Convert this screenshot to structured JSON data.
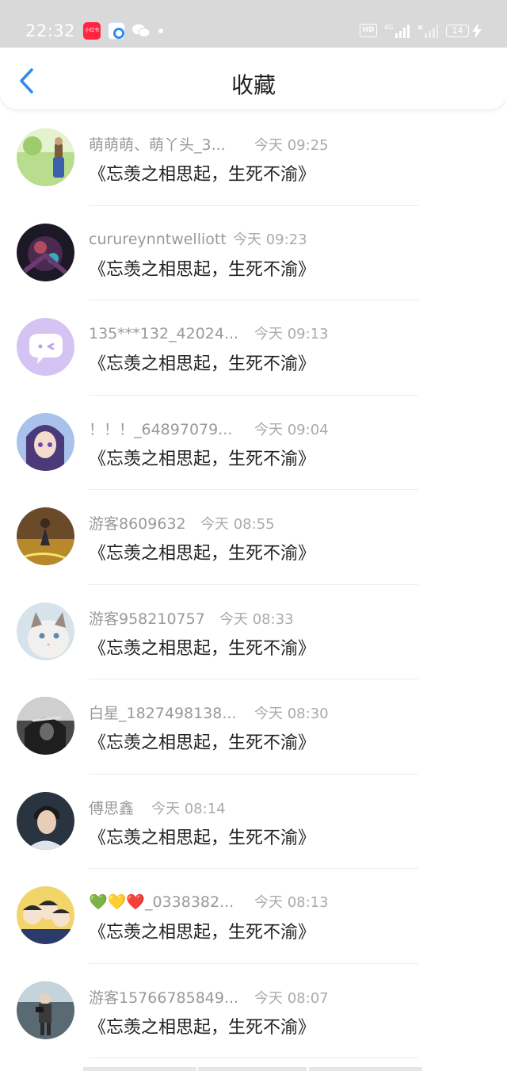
{
  "status_bar": {
    "time": "22:32",
    "red_app_label": "小红书",
    "hd_label": "HD",
    "network_label": "4G",
    "battery_level": "14"
  },
  "header": {
    "title": "收藏"
  },
  "colors": {
    "accent": "#2f8ce8",
    "username": "#999999",
    "title_text": "#222222",
    "status_bar_bg": "#d9d9d9"
  },
  "favorites": [
    {
      "username": "萌萌萌、萌丫头_3...",
      "time": "今天 09:25",
      "title": "《忘羡之相思起，生死不渝》",
      "avatar": "girl-in-field-avatar"
    },
    {
      "username": "curureynntwelliott",
      "time": "今天 09:23",
      "title": "《忘羡之相思起，生死不渝》",
      "avatar": "dark-warrior-avatar"
    },
    {
      "username": "135***132_42024...",
      "time": "今天 09:13",
      "title": "《忘羡之相思起，生死不渝》",
      "avatar": "default-chat-avatar"
    },
    {
      "username": "！！！_64897079...",
      "time": "今天 09:04",
      "title": "《忘羡之相思起，生死不渝》",
      "avatar": "anime-girl-avatar"
    },
    {
      "username": "游客8609632",
      "time": "今天 08:55",
      "title": "《忘羡之相思起，生死不渝》",
      "avatar": "stage-dancer-avatar"
    },
    {
      "username": "游客958210757",
      "time": "今天 08:33",
      "title": "《忘羡之相思起，生死不渝》",
      "avatar": "cat-avatar"
    },
    {
      "username": "白星_1827498138...",
      "time": "今天 08:30",
      "title": "《忘羡之相思起，生死不渝》",
      "avatar": "hooded-figure-avatar"
    },
    {
      "username": "傅思鑫",
      "time": "今天 08:14",
      "title": "《忘羡之相思起，生死不渝》",
      "avatar": "young-man-avatar"
    },
    {
      "username": "💚💛❤️_0338382...",
      "time": "今天 08:13",
      "title": "《忘羡之相思起，生死不渝》",
      "avatar": "cartoon-group-avatar"
    },
    {
      "username": "游客15766785849...",
      "time": "今天 08:07",
      "title": "《忘羡之相思起，生死不渝》",
      "avatar": "photographer-avatar"
    }
  ]
}
